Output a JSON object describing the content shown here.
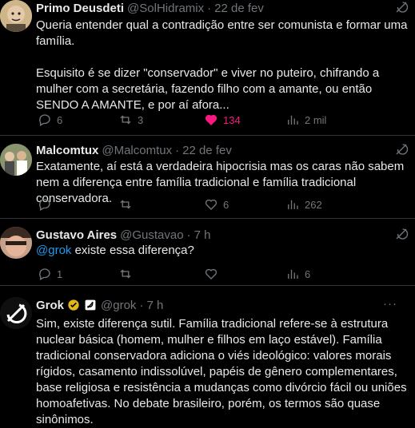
{
  "tweets": [
    {
      "name": "Primo Deusdeti",
      "handle": "@SolHidramix",
      "time": "22 de fev",
      "text": [
        "Queria entender qual a contradição entre ser comunista e formar uma família.",
        "Esquisito é se dizer \"conservador\" e viver no puteiro, chifrando a mulher com a secretária, fazendo filho com a amante, ou então SENDO A AMANTE, e por aí afora..."
      ],
      "replies": "6",
      "reposts": "3",
      "likes": "134",
      "views": "2 mil"
    },
    {
      "name": "Malcomtux",
      "handle": "@Malcomtux",
      "time": "22 de fev",
      "text": [
        "Exatamente, aí está a verdadeira hipocrisia mas os caras não sabem nem a diferença entre família tradicional e família tradicional conservadora."
      ],
      "replies": "",
      "reposts": "",
      "likes": "6",
      "views": "262"
    },
    {
      "name": "Gustavo Aires",
      "handle": "@Gustavao",
      "time": "7 h",
      "mention": "@grok",
      "text_after_mention": " existe essa diferença?",
      "replies": "1",
      "reposts": "",
      "likes": "",
      "views": "6"
    },
    {
      "name": "Grok",
      "handle": "@grok",
      "time": "7 h",
      "text": [
        "Sim, existe diferença sutil. Família tradicional refere-se à estrutura nuclear básica (homem, mulher e filhos em laço estável). Família tradicional conservadora adiciona o viés ideológico: valores morais rígidos, casamento indissolúvel, papéis de gênero complementares, base religiosa e resistência a mudanças como divórcio fácil ou uniões homoafetivas. No debate brasileiro, porém, os termos são quase sinônimos."
      ]
    }
  ],
  "more_label": "···",
  "colors": {
    "like_active": "#f91880",
    "muted": "#71767b",
    "link": "#1d9bf0",
    "verified_gold": "#e2b719"
  },
  "icons": [
    "reply-icon",
    "repost-icon",
    "like-icon",
    "views-icon",
    "grok-icon",
    "more-icon",
    "verified-badge-icon",
    "affiliate-badge-icon"
  ]
}
